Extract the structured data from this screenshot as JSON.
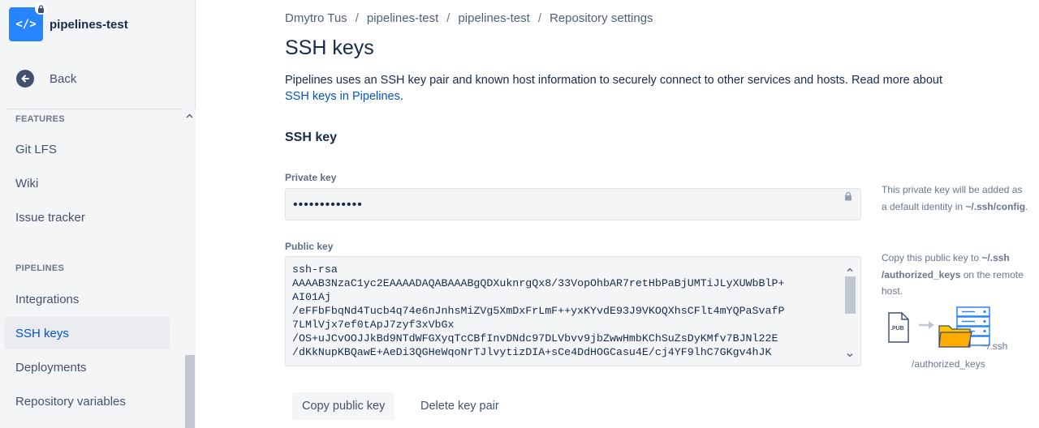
{
  "sidebar": {
    "repo_name": "pipelines-test",
    "repo_icon": "code-icon",
    "back_label": "Back",
    "sections": [
      {
        "label": "FEATURES",
        "items": [
          "Git LFS",
          "Wiki",
          "Issue tracker"
        ]
      },
      {
        "label": "PIPELINES",
        "items": [
          "Integrations",
          "SSH keys",
          "Deployments",
          "Repository variables"
        ]
      }
    ],
    "active_item": "SSH keys"
  },
  "breadcrumb": [
    "Dmytro Tus",
    "pipelines-test",
    "pipelines-test",
    "Repository settings"
  ],
  "page": {
    "title": "SSH keys",
    "intro_text": "Pipelines uses an SSH key pair and known host information to securely connect to other services and hosts. Read more about",
    "intro_link": "SSH keys in Pipelines",
    "intro_end": ".",
    "section_title": "SSH key"
  },
  "private_key": {
    "label": "Private key",
    "value": "•••••••••••••",
    "help_line1": "This private key will be added as",
    "help_line2_prefix": "a default identity in ",
    "help_line2_bold": "~/.ssh/config",
    "help_line2_suffix": "."
  },
  "public_key": {
    "label": "Public key",
    "value": "ssh-rsa\nAAAAB3NzaC1yc2EAAAADAQABAAABgQDXuknrgQx8/33VopOhbAR7retHbPaBjUMTiJLyXUWbBlP+\nAI01Aj\n/eFFbFbqNd4Tucb4q74e6nJnhsMiZVg5XmDxFrLmF++yxKYvdE93J9VKOQXhsCFlt4mYQPaSvafP\n7LMlVjx7ef0tApJ7zyf3xVbGx\n/OS+uJCvOOJJkBd9NTdWFGXyqTcCBfInvDNdc97DLVbvv9jbZwwHmbKChSuZsDyKMfv7BJNl22E\n/dKkNupKBQawE+AeDi3QGHeWqoNrTJlvytizDIA+sCe4DdHOGCasu4E/cj4YF9lhC7GKgv4hJK",
    "help_line1_prefix": "Copy this public key to ",
    "help_line1_bold": "~/.ssh",
    "help_line2_bold": "/authorized_keys",
    "help_line2_suffix": " on the remote",
    "help_line3": "host.",
    "illustration": {
      "file_badge": ".PUB",
      "dir_label": "~/.ssh",
      "file_label": "/authorized_keys"
    }
  },
  "buttons": {
    "copy": "Copy public key",
    "delete": "Delete key pair"
  },
  "colors": {
    "accent": "#0052cc",
    "repo_avatar": "#2684ff",
    "sidebar_bg": "#f4f5f7"
  }
}
